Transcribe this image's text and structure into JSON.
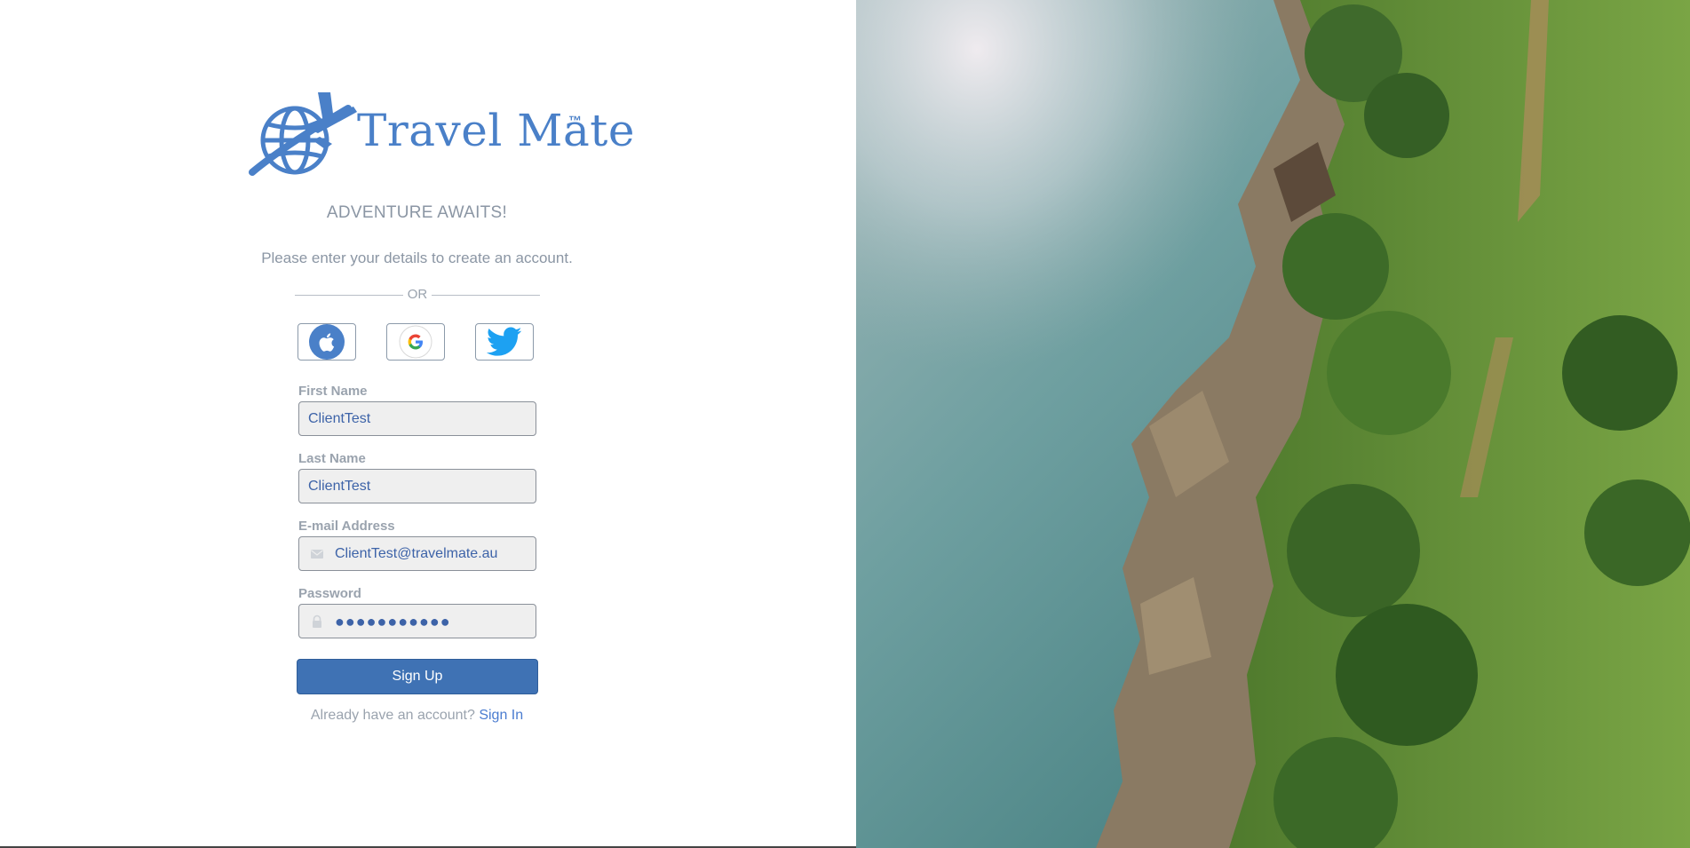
{
  "brand": {
    "name": "Travel Mate",
    "trademark": "™",
    "color": "#4a80c8",
    "logo_icon": "globe-airplane-icon"
  },
  "tagline": "ADVENTURE AWAITS!",
  "subtitle": "Please enter your details to create an account.",
  "divider_text": "OR",
  "social": [
    {
      "provider": "apple",
      "icon": "apple-icon"
    },
    {
      "provider": "google",
      "icon": "google-icon"
    },
    {
      "provider": "twitter",
      "icon": "twitter-icon"
    }
  ],
  "form": {
    "first_name": {
      "label": "First Name",
      "value": "ClientTest"
    },
    "last_name": {
      "label": "Last Name",
      "value": "ClientTest"
    },
    "email": {
      "label": "E-mail Address",
      "value": "ClientTest@travelmate.au",
      "icon": "envelope-icon"
    },
    "password": {
      "label": "Password",
      "value": "●●●●●●●●●●●",
      "icon": "lock-icon"
    }
  },
  "signup_button": "Sign Up",
  "signin": {
    "prompt": "Already have an account?",
    "link": "Sign In"
  },
  "colors": {
    "primary": "#3f72b4",
    "link": "#4a7cd0",
    "muted_text": "#9aa3ae"
  },
  "hero_image": "aerial-coastline-photo"
}
